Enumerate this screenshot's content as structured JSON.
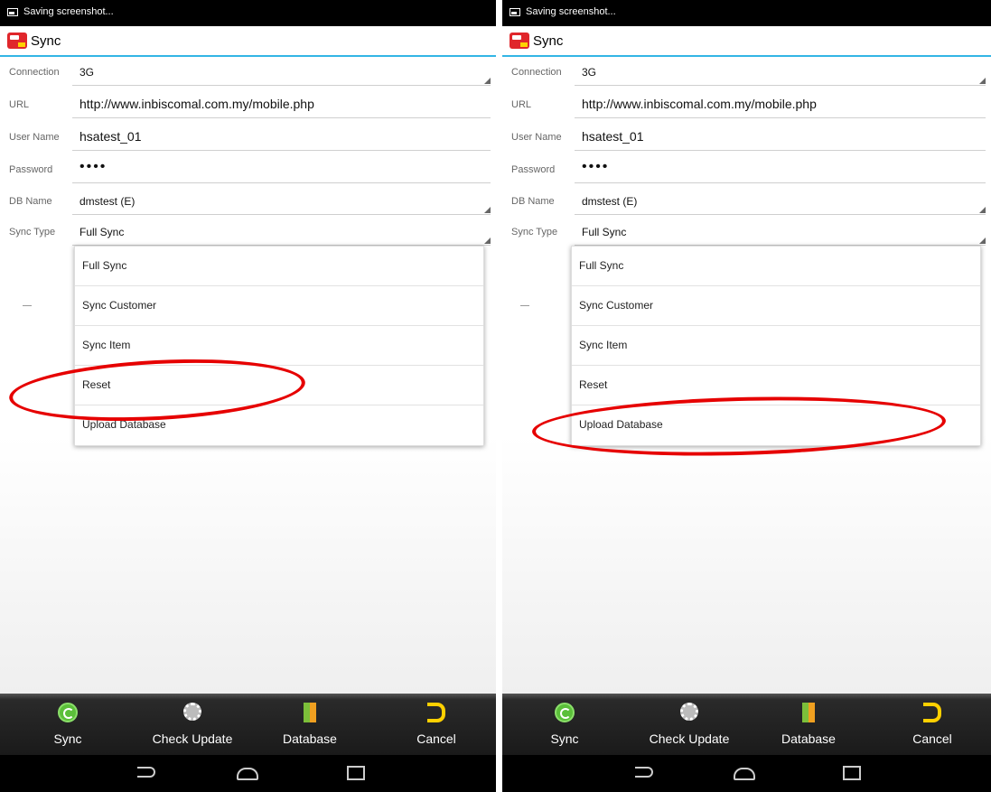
{
  "status_text": "Saving screenshot...",
  "app_title": "Sync",
  "form": {
    "connection_label": "Connection",
    "connection_value": "3G",
    "url_label": "URL",
    "url_value": "http://www.inbiscomal.com.my/mobile.php",
    "username_label": "User Name",
    "username_value": "hsatest_01",
    "password_label": "Password",
    "password_value": "••••",
    "dbname_label": "DB Name",
    "dbname_value": "dmstest (E)",
    "synctype_label": "Sync Type",
    "synctype_value": "Full Sync"
  },
  "dropdown_options": [
    "Full Sync",
    "Sync Customer",
    "Sync Item",
    "Reset",
    "Upload Database"
  ],
  "actions": {
    "sync": "Sync",
    "check_update": "Check Update",
    "database": "Database",
    "cancel": "Cancel"
  },
  "highlights": {
    "left": "Reset",
    "right": "Upload Database"
  },
  "colors": {
    "accent": "#33b5e5",
    "highlight": "#e60000"
  }
}
